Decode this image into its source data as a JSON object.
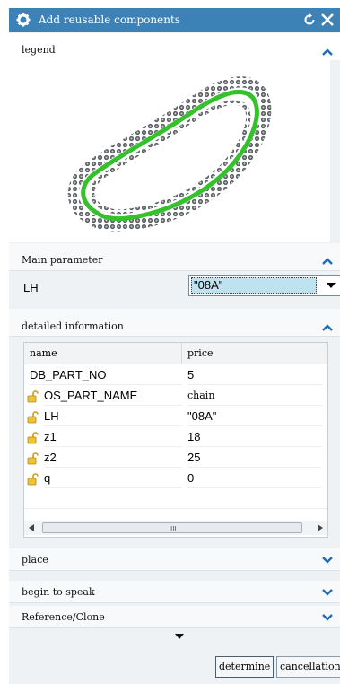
{
  "window": {
    "title": "Add reusable components",
    "title_bar_color": "#3c82b7",
    "icons": {
      "settings": "gear-icon",
      "reset": "reset-icon",
      "close": "close-icon"
    }
  },
  "sections": {
    "legend": {
      "label": "legend",
      "expanded": true
    },
    "main_parameter": {
      "label": "Main parameter",
      "expanded": true,
      "field_label": "LH",
      "selected_value": "\"08A\""
    },
    "detailed_information": {
      "label": "detailed information",
      "expanded": true,
      "columns": [
        "name",
        "price"
      ],
      "rows": [
        {
          "name": "DB_PART_NO",
          "value": "5",
          "locked": false
        },
        {
          "name": "OS_PART_NAME",
          "value": "chain",
          "locked": true
        },
        {
          "name": "LH",
          "value": "\"08A\"",
          "locked": true
        },
        {
          "name": "z1",
          "value": "18",
          "locked": true
        },
        {
          "name": "z2",
          "value": "25",
          "locked": true
        },
        {
          "name": "q",
          "value": "0",
          "locked": true
        }
      ],
      "scroll_grip": "III"
    },
    "place": {
      "label": "place",
      "expanded": false
    },
    "begin_to_speak": {
      "label": "begin to speak",
      "expanded": false
    },
    "reference_clone": {
      "label": "Reference/Clone",
      "expanded": false
    }
  },
  "buttons": {
    "determine": "determine",
    "cancellation": "cancellation"
  },
  "colors": {
    "chain_green": "#35c12c",
    "chain_gray": "#555a5e",
    "accent": "#3c82b7",
    "selection": "#bfe2f1"
  }
}
